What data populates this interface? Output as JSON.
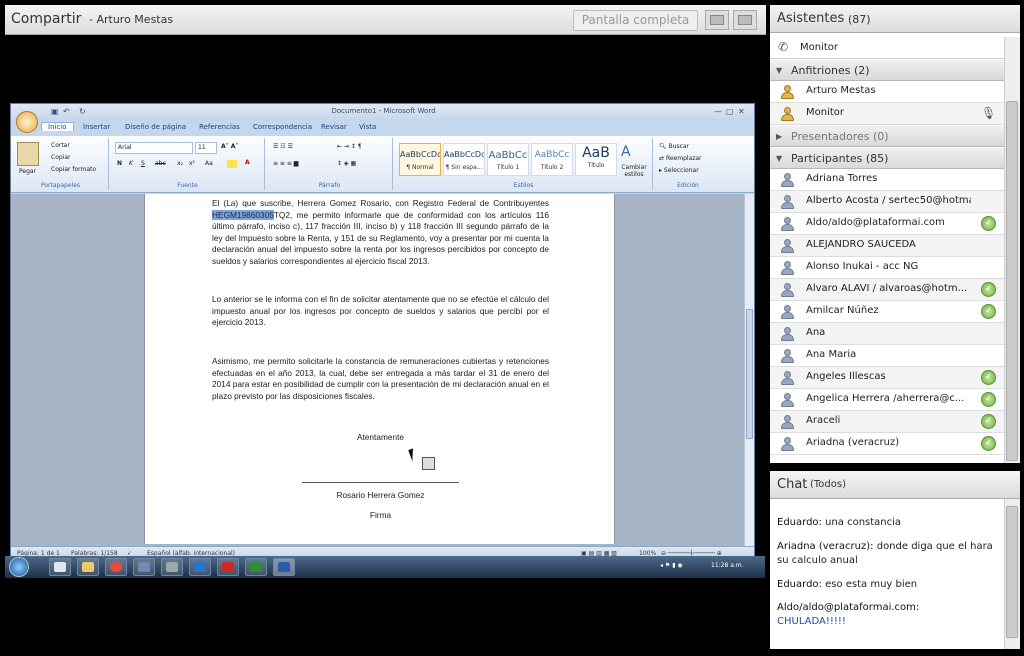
{
  "share": {
    "title": "Compartir",
    "presenter": "- Arturo Mestas",
    "fullscreen_label": "Pantalla completa"
  },
  "word": {
    "window_title": "Documento1 - Microsoft Word",
    "tabs": [
      "Inicio",
      "Insertar",
      "Diseño de página",
      "Referencias",
      "Correspondencia",
      "Revisar",
      "Vista"
    ],
    "clipboard": {
      "paste": "Pegar",
      "cut": "Cortar",
      "copy": "Copiar",
      "format_painter": "Copiar formato",
      "group": "Portapapeles"
    },
    "font": {
      "name": "Arial",
      "size": "11",
      "group": "Fuente"
    },
    "paragraph_group": "Párrafo",
    "styles": [
      {
        "preview": "AaBbCcDc",
        "name": "¶ Normal"
      },
      {
        "preview": "AaBbCcDc",
        "name": "¶ Sin espa..."
      },
      {
        "preview": "AaBbCc",
        "name": "Título 1"
      },
      {
        "preview": "AaBbCc",
        "name": "Título 2"
      },
      {
        "preview": "AaB",
        "name": "Título"
      }
    ],
    "change_styles": "Cambiar estilos",
    "styles_group": "Estilos",
    "editing": {
      "find": "Buscar",
      "replace": "Reemplazar",
      "select": "Seleccionar",
      "group": "Edición"
    },
    "document": {
      "para1_pre": "El (La) que suscribe, Herrera Gomez Rosario, con Registro Federal de Contribuyentes ",
      "para1_hl": "HEGM19860305",
      "para1_post": "TQ2, me permito informarle que de conformidad con los artículos 116 último párrafo, inciso c), 117 fracción III, inciso b) y 118 fracción III segundo párrafo de la ley del Impuesto sobre la Renta, y 151 de su Reglamento, voy a presentar por mi cuenta la declaración anual del impuesto sobre la renta por los ingresos percibidos por concepto de sueldos y salarios correspondientes al ejercicio fiscal 2013.",
      "para2": "Lo anterior se le informa con el fin de solicitar atentamente que no se efectúe el cálculo del impuesto anual por los ingresos por concepto de sueldos y salarios que percibí por el ejercicio 2013.",
      "para3": "Asimismo, me permito solicitarle la constancia de remuneraciones cubiertas y retenciones efectuadas en el año 2013, la cual, debe ser entregada a más tardar el 31 de enero del 2014 para estar en posibilidad de cumplir con la presentación de mi declaración anual en el plazo previsto por las disposiciones fiscales.",
      "closing": "Atentamente",
      "signer": "Rosario Herrera Gomez",
      "signature": "Firma"
    },
    "status": {
      "page": "Página: 1 de 1",
      "words": "Palabras: 1/158",
      "language": "Español (alfab. internacional)",
      "zoom": "100%"
    },
    "clock": "11:28 a.m."
  },
  "attendees": {
    "title": "Asistentes",
    "count": "(87)",
    "monitor_label": "Monitor",
    "hosts_label": "Anfitriones (2)",
    "hosts": [
      "Arturo Mestas",
      "Monitor"
    ],
    "presenters_label": "Presentadores (0)",
    "participants_label": "Participantes (85)",
    "participants": [
      {
        "name": "Adriana Torres",
        "status": false
      },
      {
        "name": "Alberto Acosta / sertec50@hotmail....",
        "status": false
      },
      {
        "name": "Aldo/aldo@plataformai.com",
        "status": true
      },
      {
        "name": "ALEJANDRO SAUCEDA",
        "status": false
      },
      {
        "name": "Alonso Inukai - acc NG",
        "status": false
      },
      {
        "name": "Alvaro ALAVI / alvaroas@hotm...",
        "status": true
      },
      {
        "name": "Amilcar Núñez",
        "status": true
      },
      {
        "name": "Ana",
        "status": false
      },
      {
        "name": "Ana Maria",
        "status": false
      },
      {
        "name": "Angeles Illescas",
        "status": true
      },
      {
        "name": "Angelica Herrera /aherrera@c...",
        "status": true
      },
      {
        "name": "Araceli",
        "status": true
      },
      {
        "name": "Ariadna (veracruz)",
        "status": true
      }
    ]
  },
  "chat": {
    "title": "Chat",
    "scope": "(Todos)",
    "messages": [
      {
        "sender": "Eduardo:",
        "text": "una constancia"
      },
      {
        "sender": "Ariadna (veracruz):",
        "text": "donde diga que el hara su calculo anual"
      },
      {
        "sender": "Eduardo:",
        "text": "eso esta muy bien"
      },
      {
        "sender": "Aldo/aldo@plataformai.com:",
        "text": "CHULADA!!!!!"
      }
    ]
  }
}
